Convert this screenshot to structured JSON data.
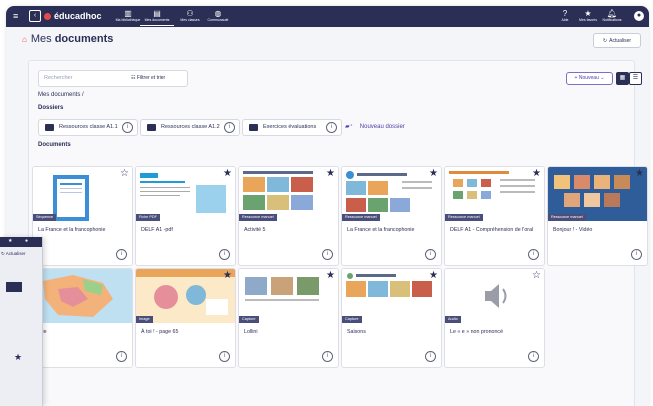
{
  "topbar": {
    "brand": "éducadhoc",
    "nav": [
      {
        "label": "Ma bibliothèque",
        "icon": "library-icon"
      },
      {
        "label": "Mes documents",
        "icon": "documents-icon",
        "active": true
      },
      {
        "label": "Mes classes",
        "icon": "classes-icon"
      },
      {
        "label": "Communauté",
        "icon": "globe-icon"
      }
    ],
    "right": [
      {
        "label": "Aide",
        "icon": "help-icon"
      },
      {
        "label": "Mes favoris",
        "icon": "star-icon"
      },
      {
        "label": "Notifications",
        "icon": "bell-icon"
      }
    ]
  },
  "header": {
    "title_prefix": "Mes ",
    "title_bold": "documents",
    "refresh_label": "Actualiser"
  },
  "toolbar": {
    "search_placeholder": "Rechercher",
    "filter_label": "Filtrer et trier",
    "new_label": "+ Nouveau ⌄"
  },
  "breadcrumb": "Mes documents /",
  "folders_heading": "Dossiers",
  "folders": [
    {
      "label": "Ressources classe A1.1"
    },
    {
      "label": "Ressources classe A1.2"
    },
    {
      "label": "Exercices évaluations"
    }
  ],
  "new_folder_label": "Nouveau dossier",
  "documents_heading": "Documents",
  "documents": [
    {
      "title": "La France et la francophonie",
      "badge": "Séquence",
      "starred": false
    },
    {
      "title": "DELF A1 -pdf",
      "badge": "Fiche PDF",
      "starred": true
    },
    {
      "title": "Activité 5",
      "badge": "Ressource manuel",
      "starred": true
    },
    {
      "title": "La France et la francophonie",
      "badge": "Ressource manuel",
      "starred": true
    },
    {
      "title": "DELF A1 - Compréhension de l'oral",
      "badge": "Ressource manuel",
      "starred": true
    },
    {
      "title": "Bonjour ! - Vidéo",
      "badge": "Ressource manuel",
      "starred": true
    },
    {
      "title": "...ie",
      "badge": "",
      "starred": false
    },
    {
      "title": "À toi ! - page 65",
      "badge": "Image",
      "starred": true
    },
    {
      "title": "Lollini",
      "badge": "Capture",
      "starred": true
    },
    {
      "title": "Saisons",
      "badge": "Capture",
      "starred": true
    },
    {
      "title": "Le « e » non prononcé",
      "badge": "Audio",
      "starred": false
    }
  ],
  "side_panel": {
    "refresh_label": "Actualiser"
  },
  "colors": {
    "navy": "#2b2f56",
    "accent": "#e74a4a",
    "purple": "#4b3fa8"
  }
}
